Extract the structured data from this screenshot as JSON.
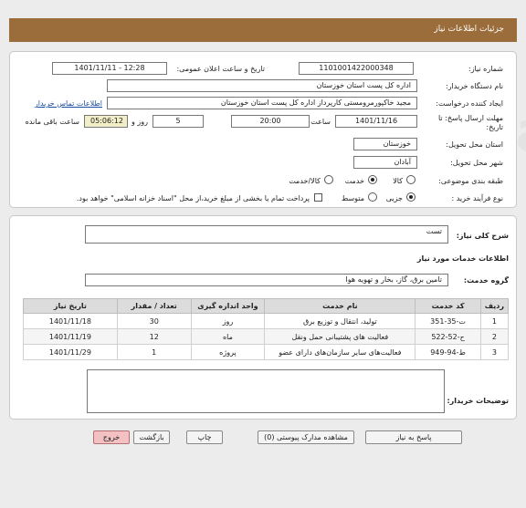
{
  "header": {
    "title": "جزئیات اطلاعات نیاز"
  },
  "info": {
    "need_number_label": "شماره نیاز:",
    "need_number": "1101001422000348",
    "announce_label": "تاریخ و ساعت اعلان عمومی:",
    "announce_value": "1401/11/11 - 12:28",
    "buyer_org_label": "نام دستگاه خریدار:",
    "buyer_org": "اداره کل پست استان خوزستان",
    "requester_label": "ایجاد کننده درخواست:",
    "requester": "مجید خاکپورمرومستی کارپرداز اداره کل پست استان خوزستان",
    "contact_link": "اطلاعات تماس خریدار",
    "deadline_label": "مهلت ارسال پاسخ: تا تاریخ:",
    "deadline_date": "1401/11/16",
    "time_label": "ساعت",
    "deadline_time": "20:00",
    "days_value": "5",
    "days_label": "روز و",
    "remaining_time": "05:06:12",
    "remaining_label": "ساعت باقی مانده",
    "province_label": "استان محل تحویل:",
    "province": "خوزستان",
    "city_label": "شهر محل تحویل:",
    "city": "آبادان",
    "category_label": "طبقه بندی موضوعی:",
    "category_options": [
      "کالا",
      "خدمت",
      "کالا/خدمت"
    ],
    "category_selected": "خدمت",
    "purchase_label": "نوع فرآیند خرید :",
    "purchase_options": [
      "جزیی",
      "متوسط"
    ],
    "purchase_selected": "جزیی",
    "treasury_note": "پرداخت تمام یا بخشی از مبلغ خرید،از محل \"اسناد خزانه اسلامی\" خواهد بود."
  },
  "details": {
    "desc_label": "شرح کلی نیاز:",
    "desc_value": "تست",
    "services_heading": "اطلاعات خدمات مورد نیاز",
    "group_label": "گروه خدمت:",
    "group_value": "تامین برق، گاز، بخار و تهویه هوا",
    "columns": [
      "ردیف",
      "کد خدمت",
      "نام خدمت",
      "واحد اندازه گیری",
      "تعداد / مقدار",
      "تاریخ نیاز"
    ],
    "rows": [
      [
        "1",
        "ت-35-351",
        "تولید، انتقال و توزیع برق",
        "روز",
        "30",
        "1401/11/18"
      ],
      [
        "2",
        "ح-52-522",
        "فعالیت های پشتیبانی حمل ونقل",
        "ماه",
        "12",
        "1401/11/19"
      ],
      [
        "3",
        "ط-94-949",
        "فعالیت‌های سایر سازمان‌های دارای عضو",
        "پروژه",
        "1",
        "1401/11/29"
      ]
    ],
    "buyer_notes_label": "توضیحات خریدار:"
  },
  "buttons": {
    "reply": "پاسخ به نیاز",
    "attachments": "مشاهده مدارک پیوستی (0)",
    "print": "چاپ",
    "back": "بازگشت",
    "exit": "خروج"
  },
  "watermark": "ParsNamadData"
}
